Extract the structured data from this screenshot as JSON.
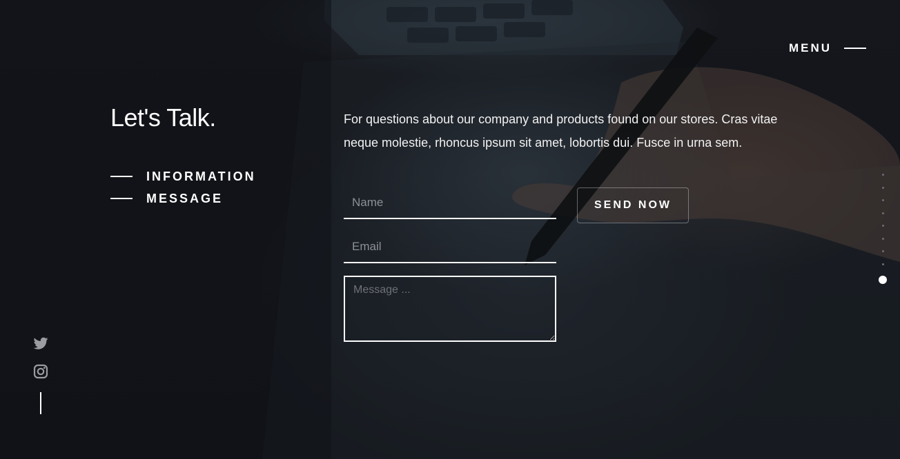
{
  "header": {
    "menu_label": "MENU"
  },
  "contact": {
    "title": "Let's Talk.",
    "nav": [
      {
        "label": "INFORMATION"
      },
      {
        "label": "MESSAGE"
      }
    ],
    "intro": "For questions about our company and products found on our stores. Cras vitae neque molestie, rhoncus ipsum sit amet, lobortis dui. Fusce in urna sem."
  },
  "form": {
    "name_placeholder": "Name",
    "email_placeholder": "Email",
    "message_placeholder": "Message ...",
    "name_value": "",
    "email_value": "",
    "message_value": "",
    "submit_label": "SEND NOW"
  },
  "pager": {
    "dot_count": 9,
    "active_index": 8
  },
  "social": {
    "icons": [
      "twitter-icon",
      "instagram-icon"
    ]
  },
  "colors": {
    "background": "#121419",
    "text": "#ffffff",
    "placeholder": "#8d9096",
    "dot_inactive": "#6b6e74"
  }
}
